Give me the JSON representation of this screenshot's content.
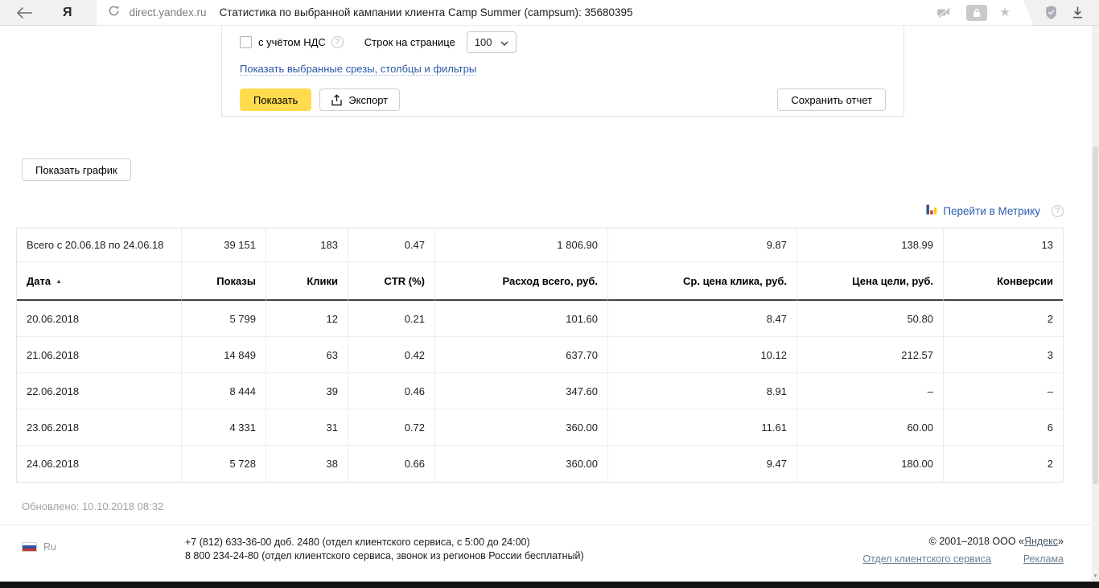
{
  "browser": {
    "logo": "Я",
    "url": "direct.yandex.ru",
    "title": "Статистика по выбранной кампании клиента Camp Summer (campsum): 35680395"
  },
  "panel": {
    "vat_label": "с учётом НДС",
    "rows_per_page_label": "Строк на странице",
    "rows_per_page_value": "100",
    "slices_link": "Показать выбранные срезы, столбцы и фильтры",
    "show_button": "Показать",
    "export_button": "Экспорт",
    "save_report_button": "Сохранить отчет"
  },
  "actions": {
    "show_chart_button": "Показать график",
    "metrika_link": "Перейти в Метрику"
  },
  "table": {
    "columns": [
      "Дата",
      "Показы",
      "Клики",
      "CTR (%)",
      "Расход всего, руб.",
      "Ср. цена клика, руб.",
      "Цена цели, руб.",
      "Конверсии"
    ],
    "total": {
      "label": "Всего с 20.06.18 по 24.06.18",
      "values": [
        "39 151",
        "183",
        "0.47",
        "1 806.90",
        "9.87",
        "138.99",
        "13"
      ]
    },
    "rows": [
      {
        "date": "20.06.2018",
        "values": [
          "5 799",
          "12",
          "0.21",
          "101.60",
          "8.47",
          "50.80",
          "2"
        ]
      },
      {
        "date": "21.06.2018",
        "values": [
          "14 849",
          "63",
          "0.42",
          "637.70",
          "10.12",
          "212.57",
          "3"
        ]
      },
      {
        "date": "22.06.2018",
        "values": [
          "8 444",
          "39",
          "0.46",
          "347.60",
          "8.91",
          "–",
          "–"
        ]
      },
      {
        "date": "23.06.2018",
        "values": [
          "4 331",
          "31",
          "0.72",
          "360.00",
          "11.61",
          "60.00",
          "6"
        ]
      },
      {
        "date": "24.06.2018",
        "values": [
          "5 728",
          "38",
          "0.66",
          "360.00",
          "9.47",
          "180.00",
          "2"
        ]
      }
    ]
  },
  "status": {
    "updated": "Обновлено: 10.10.2018 08:32"
  },
  "footer": {
    "lang": "Ru",
    "phone1": "+7 (812) 633-36-00 доб. 2480 (отдел клиентского сервиса, с 5:00 до 24:00)",
    "phone2": "8 800 234-24-80 (отдел клиентского сервиса, звонок из регионов России бесплатный)",
    "copyright_prefix": "© 2001–2018  ООО «",
    "copyright_link": "Яндекс",
    "copyright_suffix": "»",
    "links": [
      "Отдел клиентского сервиса",
      "Реклама"
    ]
  },
  "icons": {
    "star": "★",
    "sort_asc": "▲",
    "scroll_down": "▼",
    "help": "?"
  },
  "colors": {
    "accent_yellow": "#ffdb4d",
    "link_blue": "#2a5db0",
    "metrika_blue": "#33517b",
    "metrika_red": "#d93b2b",
    "metrika_yellow": "#f7c825"
  }
}
